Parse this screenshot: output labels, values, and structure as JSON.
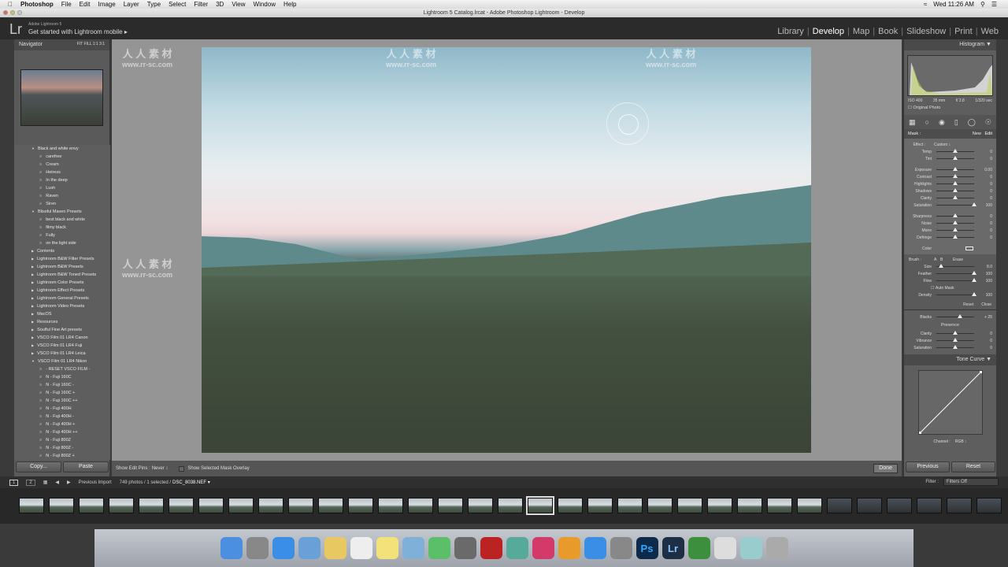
{
  "menubar": {
    "app": "Photoshop",
    "items": [
      "File",
      "Edit",
      "Image",
      "Layer",
      "Type",
      "Select",
      "Filter",
      "3D",
      "View",
      "Window",
      "Help"
    ],
    "clock": "Wed 11:26 AM"
  },
  "window": {
    "title": "Lightroom 5 Catalog.lrcat - Adobe Photoshop Lightroom - Develop"
  },
  "header": {
    "logo": "Lr",
    "product": "Adobe Lightroom 5",
    "mobile": "Get started with Lightroom mobile ▸",
    "modules": [
      "Library",
      "Develop",
      "Map",
      "Book",
      "Slideshow",
      "Print",
      "Web"
    ],
    "active_module": "Develop"
  },
  "left": {
    "navigator": "Navigator",
    "zoom_options": "FIT  FILL  1:1  3:1",
    "presets": [
      {
        "t": "folder",
        "open": true,
        "label": "Black and white envy"
      },
      {
        "t": "preset",
        "label": "carefree"
      },
      {
        "t": "preset",
        "label": "Cream"
      },
      {
        "t": "preset",
        "label": "Heiress"
      },
      {
        "t": "preset",
        "label": "In the deep"
      },
      {
        "t": "preset",
        "label": "Lush"
      },
      {
        "t": "preset",
        "label": "Raven"
      },
      {
        "t": "preset",
        "label": "Siren"
      },
      {
        "t": "folder",
        "open": true,
        "label": "Blissful Maven Presets"
      },
      {
        "t": "preset",
        "label": "best black and white"
      },
      {
        "t": "preset",
        "label": "filmy black"
      },
      {
        "t": "preset",
        "label": "Fully"
      },
      {
        "t": "preset",
        "label": "on the light side"
      },
      {
        "t": "folder",
        "label": "Contents"
      },
      {
        "t": "folder",
        "label": "Lightroom B&W Filter Presets"
      },
      {
        "t": "folder",
        "label": "Lightroom B&W Presets"
      },
      {
        "t": "folder",
        "label": "Lightroom B&W Toned Presets"
      },
      {
        "t": "folder",
        "label": "Lightroom Color Presets"
      },
      {
        "t": "folder",
        "label": "Lightroom Effect Presets"
      },
      {
        "t": "folder",
        "label": "Lightroom General Presets"
      },
      {
        "t": "folder",
        "label": "Lightroom Video Presets"
      },
      {
        "t": "folder",
        "label": "MacOS"
      },
      {
        "t": "folder",
        "label": "Resources"
      },
      {
        "t": "folder",
        "label": "Soulful Fine Art presets"
      },
      {
        "t": "folder",
        "label": "VSCO Film 01 LR4 Canon"
      },
      {
        "t": "folder",
        "label": "VSCO Film 01 LR4 Fuji"
      },
      {
        "t": "folder",
        "label": "VSCO Film 01 LR4 Leica"
      },
      {
        "t": "folder",
        "open": true,
        "label": "VSCO Film 01 LR4 Nikon"
      },
      {
        "t": "preset",
        "label": "- RESET VSCO FILM -"
      },
      {
        "t": "preset",
        "label": "N - Fuji 160C"
      },
      {
        "t": "preset",
        "label": "N - Fuji 160C -"
      },
      {
        "t": "preset",
        "label": "N - Fuji 160C +"
      },
      {
        "t": "preset",
        "label": "N - Fuji 160C ++"
      },
      {
        "t": "preset",
        "label": "N - Fuji 400H"
      },
      {
        "t": "preset",
        "label": "N - Fuji 400H -"
      },
      {
        "t": "preset",
        "label": "N - Fuji 400H +"
      },
      {
        "t": "preset",
        "label": "N - Fuji 400H ++"
      },
      {
        "t": "preset",
        "label": "N - Fuji 800Z"
      },
      {
        "t": "preset",
        "label": "N - Fuji 800Z -"
      },
      {
        "t": "preset",
        "label": "N - Fuji 800Z +"
      }
    ],
    "copy": "Copy...",
    "paste": "Paste"
  },
  "toolbar": {
    "show_edit_pins": "Show Edit Pins :",
    "pins_value": "Never ↕",
    "mask_overlay": "Show Selected Mask Overlay",
    "done": "Done"
  },
  "right": {
    "histogram": "Histogram ▼",
    "iso": "ISO 400",
    "focal": "35 mm",
    "aperture": "f/ 2.8",
    "shutter": "1/320 sec",
    "original_photo": "Original Photo",
    "mask": "Mask :",
    "new": "New",
    "edit": "Edit",
    "effect": "Effect :",
    "effect_value": "Custom ↕",
    "sliders1": [
      {
        "l": "Temp",
        "v": "0",
        "p": 50
      },
      {
        "l": "Tint",
        "v": "0",
        "p": 50
      }
    ],
    "sliders2": [
      {
        "l": "Exposure",
        "v": "0.00",
        "p": 50
      },
      {
        "l": "Contrast",
        "v": "0",
        "p": 50
      },
      {
        "l": "Highlights",
        "v": "0",
        "p": 50
      },
      {
        "l": "Shadows",
        "v": "0",
        "p": 50
      },
      {
        "l": "Clarity",
        "v": "0",
        "p": 50
      },
      {
        "l": "Saturation",
        "v": "100",
        "p": 100
      }
    ],
    "sliders3": [
      {
        "l": "Sharpness",
        "v": "0",
        "p": 50
      },
      {
        "l": "Noise",
        "v": "0",
        "p": 50
      },
      {
        "l": "Moire",
        "v": "0",
        "p": 50
      },
      {
        "l": "Defringe",
        "v": "0",
        "p": 50
      }
    ],
    "color": "Color",
    "brush": "Brush :",
    "brush_a": "A",
    "brush_b": "B",
    "erase": "Erase",
    "sliders4": [
      {
        "l": "Size",
        "v": "8.0",
        "p": 12
      },
      {
        "l": "Feather",
        "v": "100",
        "p": 100
      },
      {
        "l": "Flow",
        "v": "100",
        "p": 100
      }
    ],
    "auto_mask": "Auto Mask",
    "sliders5": [
      {
        "l": "Density",
        "v": "100",
        "p": 100
      }
    ],
    "reset": "Reset",
    "close": "Close",
    "basic_sliders": [
      {
        "l": "Blacks",
        "v": "+ 25",
        "p": 62
      }
    ],
    "presence": "Presence",
    "presence_sliders": [
      {
        "l": "Clarity",
        "v": "0",
        "p": 50
      },
      {
        "l": "Vibrance",
        "v": "0",
        "p": 50
      },
      {
        "l": "Saturation",
        "v": "0",
        "p": 50
      }
    ],
    "tone_curve": "Tone Curve ▼",
    "channel": "Channel :",
    "channel_value": "RGB ↕",
    "previous": "Previous",
    "reset_all": "Reset"
  },
  "filmbar": {
    "view1": "1",
    "view2": "2",
    "source": "Previous Import",
    "count": "749 photos / 1 selected /",
    "filename": "DSC_8038.NEF ▾",
    "filter_label": "Filter :",
    "filter_value": "Filters Off"
  },
  "dock": {
    "icons": [
      "finder-icon",
      "launchpad-icon",
      "safari-icon",
      "mail-icon",
      "notes-icon",
      "calendar-icon",
      "stickies-icon",
      "preview-icon",
      "messages-icon",
      "facetime-icon",
      "photobooth-icon",
      "photos-icon",
      "itunes-icon",
      "ibooks-icon",
      "appstore-icon",
      "system-preferences-icon",
      "photoshop-icon",
      "lightroom-icon",
      "camtasia-icon",
      "documents-icon",
      "folder-icon",
      "trash-icon"
    ],
    "ps": "Ps",
    "lr": "Lr"
  },
  "watermark": {
    "cn": "人 人 素 材",
    "url": "www.rr-sc.com"
  },
  "colors": {
    "panel": "#5e5e5e",
    "header": "#2b2b2b",
    "center": "#959595"
  }
}
